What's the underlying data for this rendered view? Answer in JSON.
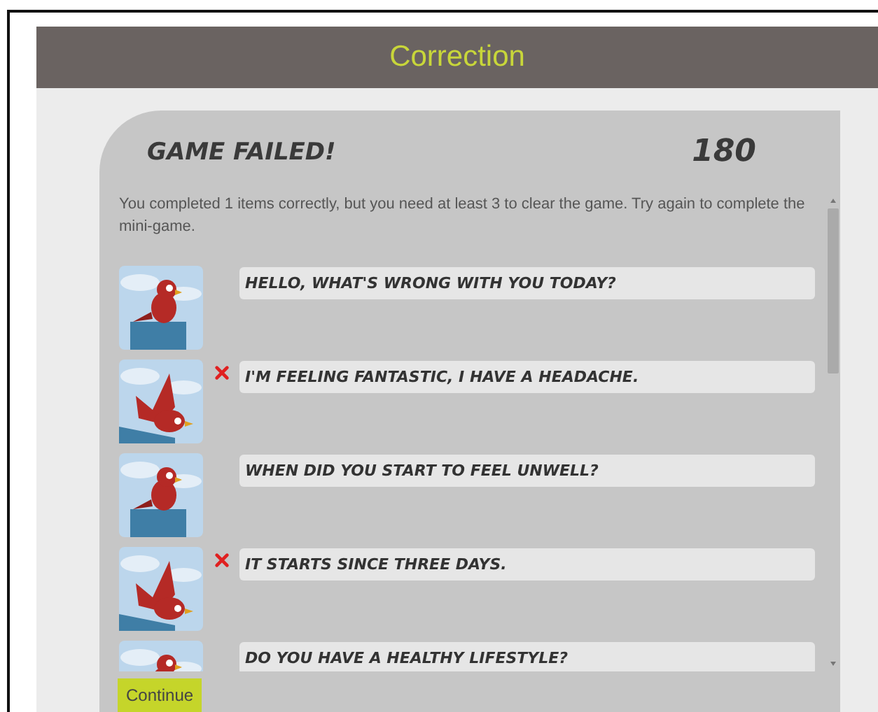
{
  "header": {
    "title": "Correction"
  },
  "result": {
    "heading": "GAME FAILED!",
    "score": "180",
    "message": "You completed 1 items correctly, but you need at least 3 to clear the game. Try again to complete the mini-game."
  },
  "items": [
    {
      "text": "HELLO, WHAT'S WRONG WITH YOU TODAY?",
      "wrong": false
    },
    {
      "text": "I'M FEELING FANTASTIC, I HAVE A HEADACHE.",
      "wrong": true
    },
    {
      "text": "WHEN DID YOU START TO FEEL UNWELL?",
      "wrong": false
    },
    {
      "text": "IT STARTS SINCE THREE DAYS.",
      "wrong": true
    },
    {
      "text": "DO YOU HAVE A HEALTHY LIFESTYLE?",
      "wrong": false
    }
  ],
  "continue_button": "Continue"
}
